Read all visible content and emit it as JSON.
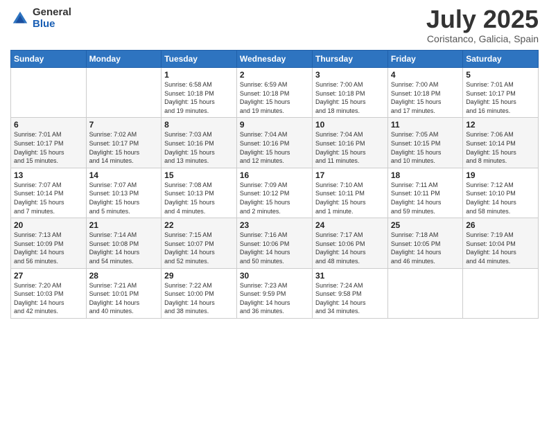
{
  "header": {
    "logo_general": "General",
    "logo_blue": "Blue",
    "month_title": "July 2025",
    "subtitle": "Coristanco, Galicia, Spain"
  },
  "days_of_week": [
    "Sunday",
    "Monday",
    "Tuesday",
    "Wednesday",
    "Thursday",
    "Friday",
    "Saturday"
  ],
  "weeks": [
    [
      {
        "day": "",
        "info": ""
      },
      {
        "day": "",
        "info": ""
      },
      {
        "day": "1",
        "info": "Sunrise: 6:58 AM\nSunset: 10:18 PM\nDaylight: 15 hours\nand 19 minutes."
      },
      {
        "day": "2",
        "info": "Sunrise: 6:59 AM\nSunset: 10:18 PM\nDaylight: 15 hours\nand 19 minutes."
      },
      {
        "day": "3",
        "info": "Sunrise: 7:00 AM\nSunset: 10:18 PM\nDaylight: 15 hours\nand 18 minutes."
      },
      {
        "day": "4",
        "info": "Sunrise: 7:00 AM\nSunset: 10:18 PM\nDaylight: 15 hours\nand 17 minutes."
      },
      {
        "day": "5",
        "info": "Sunrise: 7:01 AM\nSunset: 10:17 PM\nDaylight: 15 hours\nand 16 minutes."
      }
    ],
    [
      {
        "day": "6",
        "info": "Sunrise: 7:01 AM\nSunset: 10:17 PM\nDaylight: 15 hours\nand 15 minutes."
      },
      {
        "day": "7",
        "info": "Sunrise: 7:02 AM\nSunset: 10:17 PM\nDaylight: 15 hours\nand 14 minutes."
      },
      {
        "day": "8",
        "info": "Sunrise: 7:03 AM\nSunset: 10:16 PM\nDaylight: 15 hours\nand 13 minutes."
      },
      {
        "day": "9",
        "info": "Sunrise: 7:04 AM\nSunset: 10:16 PM\nDaylight: 15 hours\nand 12 minutes."
      },
      {
        "day": "10",
        "info": "Sunrise: 7:04 AM\nSunset: 10:16 PM\nDaylight: 15 hours\nand 11 minutes."
      },
      {
        "day": "11",
        "info": "Sunrise: 7:05 AM\nSunset: 10:15 PM\nDaylight: 15 hours\nand 10 minutes."
      },
      {
        "day": "12",
        "info": "Sunrise: 7:06 AM\nSunset: 10:14 PM\nDaylight: 15 hours\nand 8 minutes."
      }
    ],
    [
      {
        "day": "13",
        "info": "Sunrise: 7:07 AM\nSunset: 10:14 PM\nDaylight: 15 hours\nand 7 minutes."
      },
      {
        "day": "14",
        "info": "Sunrise: 7:07 AM\nSunset: 10:13 PM\nDaylight: 15 hours\nand 5 minutes."
      },
      {
        "day": "15",
        "info": "Sunrise: 7:08 AM\nSunset: 10:13 PM\nDaylight: 15 hours\nand 4 minutes."
      },
      {
        "day": "16",
        "info": "Sunrise: 7:09 AM\nSunset: 10:12 PM\nDaylight: 15 hours\nand 2 minutes."
      },
      {
        "day": "17",
        "info": "Sunrise: 7:10 AM\nSunset: 10:11 PM\nDaylight: 15 hours\nand 1 minute."
      },
      {
        "day": "18",
        "info": "Sunrise: 7:11 AM\nSunset: 10:11 PM\nDaylight: 14 hours\nand 59 minutes."
      },
      {
        "day": "19",
        "info": "Sunrise: 7:12 AM\nSunset: 10:10 PM\nDaylight: 14 hours\nand 58 minutes."
      }
    ],
    [
      {
        "day": "20",
        "info": "Sunrise: 7:13 AM\nSunset: 10:09 PM\nDaylight: 14 hours\nand 56 minutes."
      },
      {
        "day": "21",
        "info": "Sunrise: 7:14 AM\nSunset: 10:08 PM\nDaylight: 14 hours\nand 54 minutes."
      },
      {
        "day": "22",
        "info": "Sunrise: 7:15 AM\nSunset: 10:07 PM\nDaylight: 14 hours\nand 52 minutes."
      },
      {
        "day": "23",
        "info": "Sunrise: 7:16 AM\nSunset: 10:06 PM\nDaylight: 14 hours\nand 50 minutes."
      },
      {
        "day": "24",
        "info": "Sunrise: 7:17 AM\nSunset: 10:06 PM\nDaylight: 14 hours\nand 48 minutes."
      },
      {
        "day": "25",
        "info": "Sunrise: 7:18 AM\nSunset: 10:05 PM\nDaylight: 14 hours\nand 46 minutes."
      },
      {
        "day": "26",
        "info": "Sunrise: 7:19 AM\nSunset: 10:04 PM\nDaylight: 14 hours\nand 44 minutes."
      }
    ],
    [
      {
        "day": "27",
        "info": "Sunrise: 7:20 AM\nSunset: 10:03 PM\nDaylight: 14 hours\nand 42 minutes."
      },
      {
        "day": "28",
        "info": "Sunrise: 7:21 AM\nSunset: 10:01 PM\nDaylight: 14 hours\nand 40 minutes."
      },
      {
        "day": "29",
        "info": "Sunrise: 7:22 AM\nSunset: 10:00 PM\nDaylight: 14 hours\nand 38 minutes."
      },
      {
        "day": "30",
        "info": "Sunrise: 7:23 AM\nSunset: 9:59 PM\nDaylight: 14 hours\nand 36 minutes."
      },
      {
        "day": "31",
        "info": "Sunrise: 7:24 AM\nSunset: 9:58 PM\nDaylight: 14 hours\nand 34 minutes."
      },
      {
        "day": "",
        "info": ""
      },
      {
        "day": "",
        "info": ""
      }
    ]
  ]
}
